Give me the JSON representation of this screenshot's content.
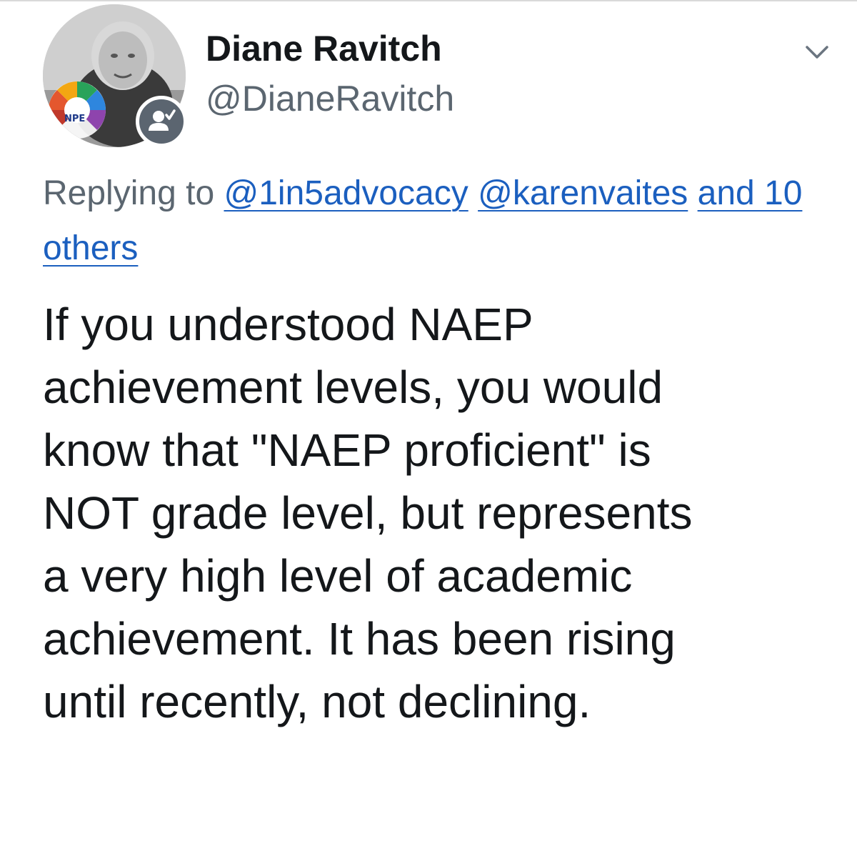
{
  "author": {
    "name": "Diane Ravitch",
    "handle": "@DianeRavitch",
    "avatar_logo_text": "NPE",
    "badge_icon": "person-check-icon"
  },
  "menu": {
    "icon": "chevron-down-icon"
  },
  "reply": {
    "prefix": "Replying to",
    "mention_1": "@1in5advocacy",
    "mention_2": "@karenvaites",
    "others": "and 10 others",
    "link_color": "#1b5fbf"
  },
  "tweet": {
    "lines": [
      "If you understood NAEP",
      "achievement levels, you would",
      "know that \"NAEP proficient\" is",
      "NOT grade level, but represents",
      "a very high level of academic",
      "achievement. It has been rising",
      "until recently, not declining."
    ]
  },
  "colors": {
    "text": "#14171a",
    "secondary": "#5b6670",
    "badge": "#5b6570"
  }
}
